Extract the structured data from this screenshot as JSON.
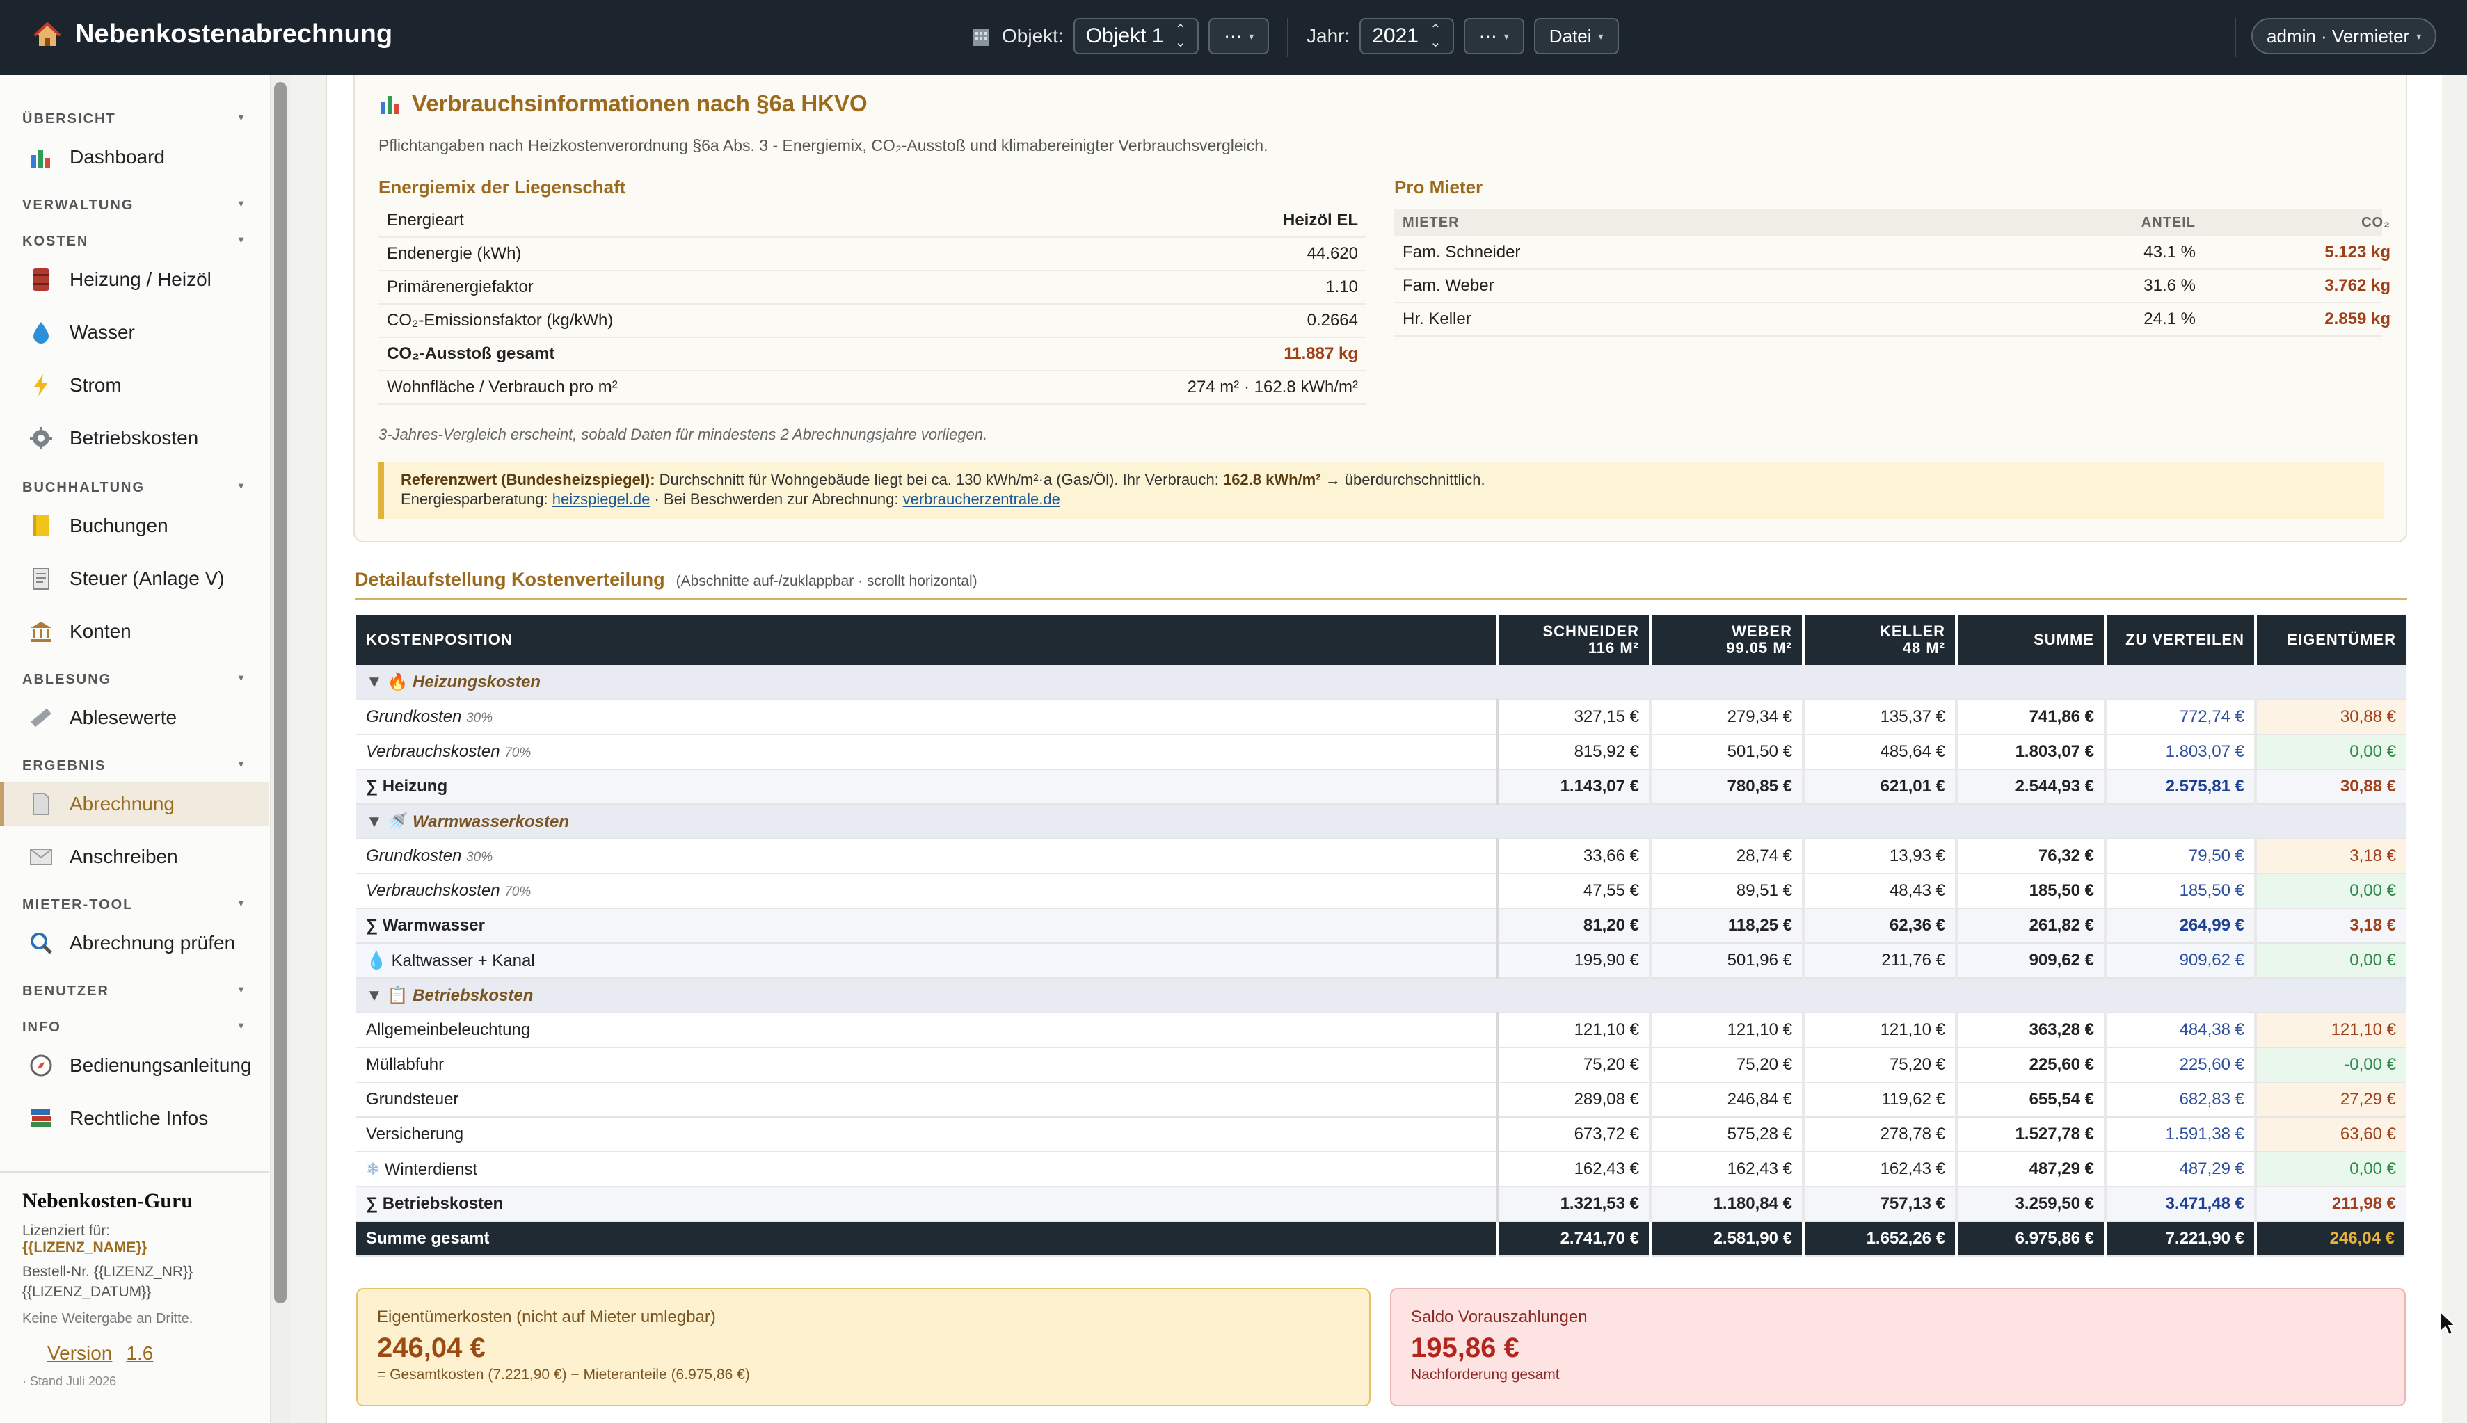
{
  "app": {
    "title": "Nebenkostenabrechnung"
  },
  "topbar": {
    "objekt_label": "Objekt:",
    "objekt_value": "Objekt 1",
    "more1": "⋯",
    "jahr_label": "Jahr:",
    "jahr_value": "2021",
    "more2": "⋯",
    "datei": "Datei",
    "user": "admin · Vermieter"
  },
  "sidebar": {
    "sections": {
      "uebersicht": "ÜBERSICHT",
      "verwaltung": "VERWALTUNG",
      "kosten": "KOSTEN",
      "buchhaltung": "BUCHHALTUNG",
      "ablesung": "ABLESUNG",
      "ergebnis": "ERGEBNIS",
      "mietertool": "MIETER-TOOL",
      "benutzer": "BENUTZER",
      "info": "INFO"
    },
    "items": {
      "dashboard": "Dashboard",
      "heizung": "Heizung / Heizöl",
      "wasser": "Wasser",
      "strom": "Strom",
      "betriebskosten": "Betriebskosten",
      "buchungen": "Buchungen",
      "steuer": "Steuer (Anlage V)",
      "konten": "Konten",
      "ablesewerte": "Ablesewerte",
      "abrechnung": "Abrechnung",
      "anschreiben": "Anschreiben",
      "pruefen": "Abrechnung prüfen",
      "anleitung": "Bedienungsanleitung",
      "rechtliches": "Rechtliche Infos"
    },
    "footer": {
      "title": "Nebenkosten-Guru",
      "lic_label": "Lizenziert für:",
      "lic_name": "{{LIZENZ_NAME}}",
      "order": "Bestell-Nr. {{LIZENZ_NR}}",
      "date": "{{LIZENZ_DATUM}}",
      "notice": "Keine Weitergabe an Dritte.",
      "version_label": "Version",
      "version_num": "1.6",
      "stand": "· Stand Juli 2026"
    }
  },
  "info": {
    "title": "Verbrauchsinformationen nach §6a HKVO",
    "subtitle": "Pflichtangaben nach Heizkostenverordnung §6a Abs. 3 - Energiemix, CO₂-Ausstoß und klimabereinigter Verbrauchsvergleich.",
    "energiemix_title": "Energiemix der Liegenschaft",
    "energiemix": [
      {
        "k": "Energieart",
        "v": "Heizöl EL"
      },
      {
        "k": "Endenergie (kWh)",
        "v": "44.620"
      },
      {
        "k": "Primärenergiefaktor",
        "v": "1.10"
      },
      {
        "k": "CO₂-Emissionsfaktor (kg/kWh)",
        "v": "0.2664"
      },
      {
        "k": "CO₂-Ausstoß gesamt",
        "v": "11.887 kg"
      },
      {
        "k": "Wohnfläche / Verbrauch pro m²",
        "v": "274 m² · 162.8 kWh/m²"
      }
    ],
    "pro_mieter_title": "Pro Mieter",
    "pm_headers": {
      "mieter": "MIETER",
      "anteil": "ANTEIL",
      "co2": "CO₂"
    },
    "pro_mieter": [
      {
        "name": "Fam. Schneider",
        "anteil": "43.1 %",
        "co2": "5.123 kg"
      },
      {
        "name": "Fam. Weber",
        "anteil": "31.6 %",
        "co2": "3.762 kg"
      },
      {
        "name": "Hr. Keller",
        "anteil": "24.1 %",
        "co2": "2.859 kg"
      }
    ],
    "note": "3-Jahres-Vergleich erscheint, sobald Daten für mindestens 2 Abrechnungsjahre vorliegen.",
    "ref_label": "Referenzwert (Bundesheizspiegel):",
    "ref_text": "Durchschnitt für Wohngebäude liegt bei ca. 130 kWh/m²·a (Gas/Öl). Ihr Verbrauch:",
    "ref_value": "162.8 kWh/m²",
    "ref_suffix": "→ überdurchschnittlich.",
    "ref_line2": "Energiesparberatung:",
    "ref_link1": "heizspiegel.de",
    "ref_mid": "· Bei Beschwerden zur Abrechnung:",
    "ref_link2": "verbraucherzentrale.de"
  },
  "detail": {
    "title": "Detailaufstellung Kostenverteilung",
    "hint": "(Abschnitte auf-/zuklappbar · scrollt horizontal)",
    "headers": {
      "pos": "KOSTENPOSITION",
      "schneider": "SCHNEIDER",
      "schneider_area": "116 M²",
      "weber": "WEBER",
      "weber_area": "99.05 M²",
      "keller": "KELLER",
      "keller_area": "48 M²",
      "summe": "SUMME",
      "verteilen": "ZU VERTEILEN",
      "eigentuemer": "EIGENTÜMER"
    },
    "groups": {
      "heizung": "Heizungskosten",
      "warmwasser": "Warmwasserkosten",
      "betrieb": "Betriebskosten"
    },
    "rows": {
      "h_grund": {
        "label": "Grundkosten",
        "pct": "30%",
        "s": "327,15 €",
        "w": "279,34 €",
        "k": "135,37 €",
        "sum": "741,86 €",
        "vt": "772,74 €",
        "eig": "30,88 €"
      },
      "h_verb": {
        "label": "Verbrauchskosten",
        "pct": "70%",
        "s": "815,92 €",
        "w": "501,50 €",
        "k": "485,64 €",
        "sum": "1.803,07 €",
        "vt": "1.803,07 €",
        "eig": "0,00 €"
      },
      "h_sum": {
        "label": "∑ Heizung",
        "s": "1.143,07 €",
        "w": "780,85 €",
        "k": "621,01 €",
        "sum": "2.544,93 €",
        "vt": "2.575,81 €",
        "eig": "30,88 €"
      },
      "w_grund": {
        "label": "Grundkosten",
        "pct": "30%",
        "s": "33,66 €",
        "w": "28,74 €",
        "k": "13,93 €",
        "sum": "76,32 €",
        "vt": "79,50 €",
        "eig": "3,18 €"
      },
      "w_verb": {
        "label": "Verbrauchskosten",
        "pct": "70%",
        "s": "47,55 €",
        "w": "89,51 €",
        "k": "48,43 €",
        "sum": "185,50 €",
        "vt": "185,50 €",
        "eig": "0,00 €"
      },
      "w_sum": {
        "label": "∑ Warmwasser",
        "s": "81,20 €",
        "w": "118,25 €",
        "k": "62,36 €",
        "sum": "261,82 €",
        "vt": "264,99 €",
        "eig": "3,18 €"
      },
      "kalt": {
        "label": "Kaltwasser + Kanal",
        "s": "195,90 €",
        "w": "501,96 €",
        "k": "211,76 €",
        "sum": "909,62 €",
        "vt": "909,62 €",
        "eig": "0,00 €"
      },
      "allg": {
        "label": "Allgemeinbeleuchtung",
        "s": "121,10 €",
        "w": "121,10 €",
        "k": "121,10 €",
        "sum": "363,28 €",
        "vt": "484,38 €",
        "eig": "121,10 €"
      },
      "muell": {
        "label": "Müllabfuhr",
        "s": "75,20 €",
        "w": "75,20 €",
        "k": "75,20 €",
        "sum": "225,60 €",
        "vt": "225,60 €",
        "eig": "-0,00 €"
      },
      "grundst": {
        "label": "Grundsteuer",
        "s": "289,08 €",
        "w": "246,84 €",
        "k": "119,62 €",
        "sum": "655,54 €",
        "vt": "682,83 €",
        "eig": "27,29 €"
      },
      "vers": {
        "label": "Versicherung",
        "s": "673,72 €",
        "w": "575,28 €",
        "k": "278,78 €",
        "sum": "1.527,78 €",
        "vt": "1.591,38 €",
        "eig": "63,60 €"
      },
      "winter": {
        "label": "Winterdienst",
        "s": "162,43 €",
        "w": "162,43 €",
        "k": "162,43 €",
        "sum": "487,29 €",
        "vt": "487,29 €",
        "eig": "0,00 €"
      },
      "b_sum": {
        "label": "∑ Betriebskosten",
        "s": "1.321,53 €",
        "w": "1.180,84 €",
        "k": "757,13 €",
        "sum": "3.259,50 €",
        "vt": "3.471,48 €",
        "eig": "211,98 €"
      },
      "total": {
        "label": "Summe gesamt",
        "s": "2.741,70 €",
        "w": "2.581,90 €",
        "k": "1.652,26 €",
        "sum": "6.975,86 €",
        "vt": "7.221,90 €",
        "eig": "246,04 €"
      }
    }
  },
  "cards": {
    "owner_title": "Eigentümerkosten (nicht auf Mieter umlegbar)",
    "owner_value": "246,04 €",
    "owner_sub": "= Gesamtkosten (7.221,90 €) − Mieteranteile (6.975,86 €)",
    "saldo_title": "Saldo Vorauszahlungen",
    "saldo_value": "195,86 €",
    "saldo_sub": "Nachforderung gesamt"
  }
}
